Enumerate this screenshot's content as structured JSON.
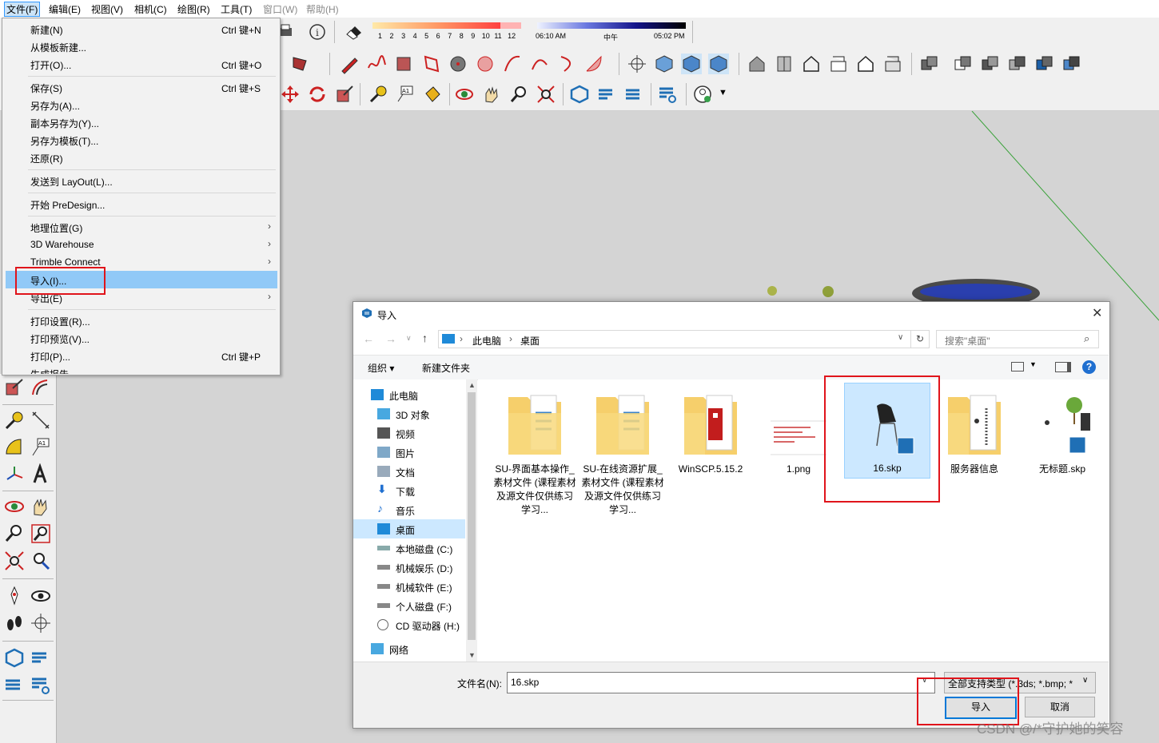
{
  "menubar": {
    "items": [
      "文件(F)",
      "编辑(E)",
      "视图(V)",
      "相机(C)",
      "绘图(R)",
      "工具(T)",
      "窗口(W)",
      "帮助(H)"
    ]
  },
  "shadow_bar": {
    "months": [
      "1",
      "2",
      "3",
      "4",
      "5",
      "6",
      "7",
      "8",
      "9",
      "10",
      "11",
      "12"
    ],
    "time_start": "06:10 AM",
    "time_mid": "中午",
    "time_end": "05:02 PM"
  },
  "file_menu": {
    "items": [
      {
        "label": "新建(N)",
        "shortcut": "Ctrl 键+N"
      },
      {
        "label": "从模板新建...",
        "shortcut": ""
      },
      {
        "label": "打开(O)...",
        "shortcut": "Ctrl 键+O"
      },
      {
        "label": "保存(S)",
        "shortcut": "Ctrl 键+S"
      },
      {
        "label": "另存为(A)...",
        "shortcut": ""
      },
      {
        "label": "副本另存为(Y)...",
        "shortcut": ""
      },
      {
        "label": "另存为模板(T)...",
        "shortcut": ""
      },
      {
        "label": "还原(R)",
        "shortcut": ""
      },
      {
        "label": "发送到 LayOut(L)...",
        "shortcut": ""
      },
      {
        "label": "开始 PreDesign...",
        "shortcut": ""
      },
      {
        "label": "地理位置(G)",
        "shortcut": ""
      },
      {
        "label": "3D Warehouse",
        "shortcut": ""
      },
      {
        "label": "Trimble Connect",
        "shortcut": ""
      },
      {
        "label": "导入(I)...",
        "shortcut": ""
      },
      {
        "label": "导出(E)",
        "shortcut": ""
      },
      {
        "label": "打印设置(R)...",
        "shortcut": ""
      },
      {
        "label": "打印预览(V)...",
        "shortcut": ""
      },
      {
        "label": "打印(P)...",
        "shortcut": "Ctrl 键+P"
      },
      {
        "label": "生成报告...",
        "shortcut": ""
      }
    ]
  },
  "dialog": {
    "title": "导入",
    "breadcrumb": [
      "此电脑",
      "桌面"
    ],
    "search_placeholder": "搜索\"桌面\"",
    "organize": "组织",
    "new_folder": "新建文件夹",
    "nav": [
      {
        "label": "此电脑"
      },
      {
        "label": "3D 对象"
      },
      {
        "label": "视频"
      },
      {
        "label": "图片"
      },
      {
        "label": "文档"
      },
      {
        "label": "下载"
      },
      {
        "label": "音乐"
      },
      {
        "label": "桌面"
      },
      {
        "label": "本地磁盘 (C:)"
      },
      {
        "label": "机械娱乐 (D:)"
      },
      {
        "label": "机械软件 (E:)"
      },
      {
        "label": "个人磁盘 (F:)"
      },
      {
        "label": "CD 驱动器 (H:)"
      },
      {
        "label": "网络"
      }
    ],
    "files": [
      {
        "name": "SU-界面基本操作_素材文件 (课程素材及源文件仅供练习学习..."
      },
      {
        "name": "SU-在线资源扩展_素材文件 (课程素材及源文件仅供练习学习..."
      },
      {
        "name": "WinSCP.5.15.2"
      },
      {
        "name": "1.png"
      },
      {
        "name": "16.skp"
      },
      {
        "name": "服务器信息"
      },
      {
        "name": "无标题.skp"
      }
    ],
    "filename_label": "文件名(N):",
    "filename_value": "16.skp",
    "filetype_value": "全部支持类型 (*.3ds; *.bmp; *",
    "import_button": "导入",
    "cancel_button": "取消"
  },
  "watermark": "CSDN @/*守护她的笑容",
  "colors": {
    "accent": "#0078d7",
    "highlight": "#91c9f7",
    "annotation": "#e0141b"
  }
}
